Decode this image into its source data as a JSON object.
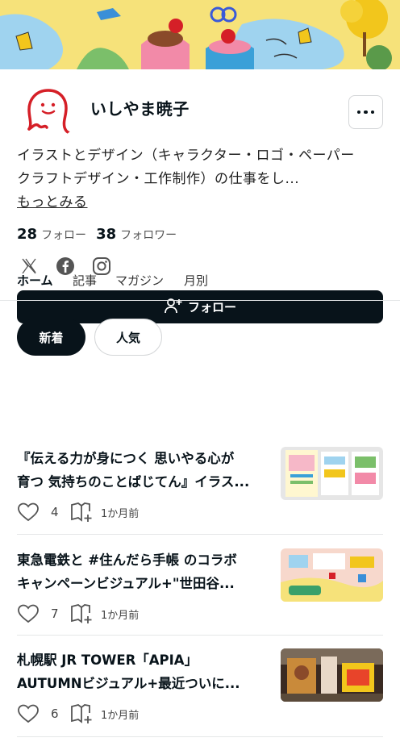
{
  "creator": {
    "name": "いしやま暁子",
    "bio_lines": [
      "イラストとデザイン（キャラクター・ロゴ・ペーパー",
      "クラフトデザイン・工作制作）の仕事をし..."
    ],
    "read_more": "もっとみる",
    "following_count": "28",
    "following_label": "フォロー",
    "followers_count": "38",
    "followers_label": "フォロワー",
    "social_icons": [
      "x-icon",
      "facebook-icon",
      "instagram-icon"
    ]
  },
  "follow_button": {
    "label": "フォロー",
    "icon": "add-user-icon"
  },
  "tabs": [
    {
      "label": "ホーム",
      "active": true
    },
    {
      "label": "記事",
      "active": false
    },
    {
      "label": "マガジン",
      "active": false
    },
    {
      "label": "月別",
      "active": false
    }
  ],
  "filters": [
    {
      "label": "新着",
      "active": true
    },
    {
      "label": "人気",
      "active": false
    }
  ],
  "articles": [
    {
      "title_lines": [
        "『伝える力が身につく 思いやる心が",
        "育つ 気持ちのことばじてん』イラス..."
      ],
      "likes": "4",
      "time": "1か月前"
    },
    {
      "title_lines": [
        "東急電鉄と #住んだら手帳 のコラボ",
        "キャンペーンビジュアル+\"世田谷..."
      ],
      "likes": "7",
      "time": "1か月前"
    },
    {
      "title_lines": [
        "札幌駅 JR TOWER「APIA」",
        "AUTUMNビジュアル+最近ついに..."
      ],
      "likes": "6",
      "time": "1か月前"
    }
  ],
  "colors": {
    "primary": "#08131a",
    "avatar_red": "#d51f27",
    "banner_yellow": "#f6e27a"
  }
}
